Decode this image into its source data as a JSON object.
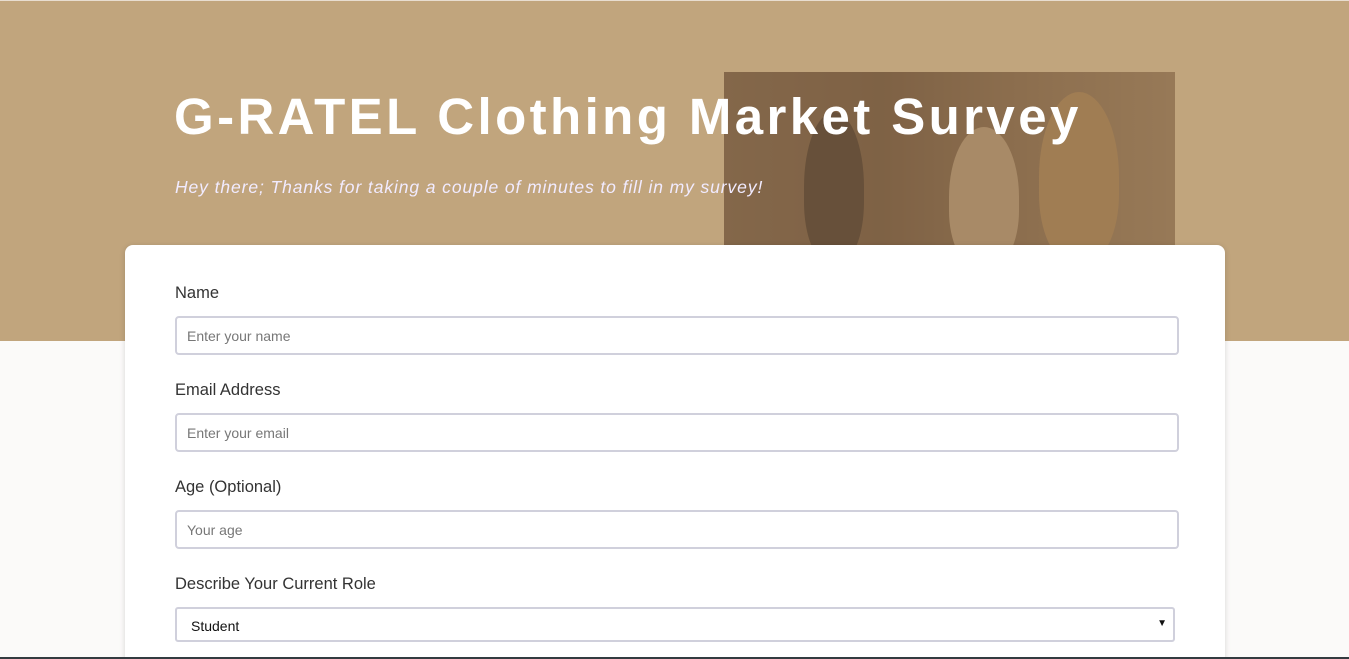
{
  "header": {
    "title": "G-RATEL Clothing Market Survey",
    "subtitle": "Hey there; Thanks for taking a couple of minutes to fill in my survey!"
  },
  "form": {
    "name": {
      "label": "Name",
      "placeholder": "Enter your name"
    },
    "email": {
      "label": "Email Address",
      "placeholder": "Enter your email"
    },
    "age": {
      "label": "Age (Optional)",
      "placeholder": "Your age"
    },
    "role": {
      "label": "Describe Your Current Role",
      "selected": "Student"
    }
  },
  "colors": {
    "hero_background": "#c1a57d",
    "page_background": "#fbfaf9",
    "title_text": "#ffffff",
    "input_border": "#d0d0dc"
  }
}
